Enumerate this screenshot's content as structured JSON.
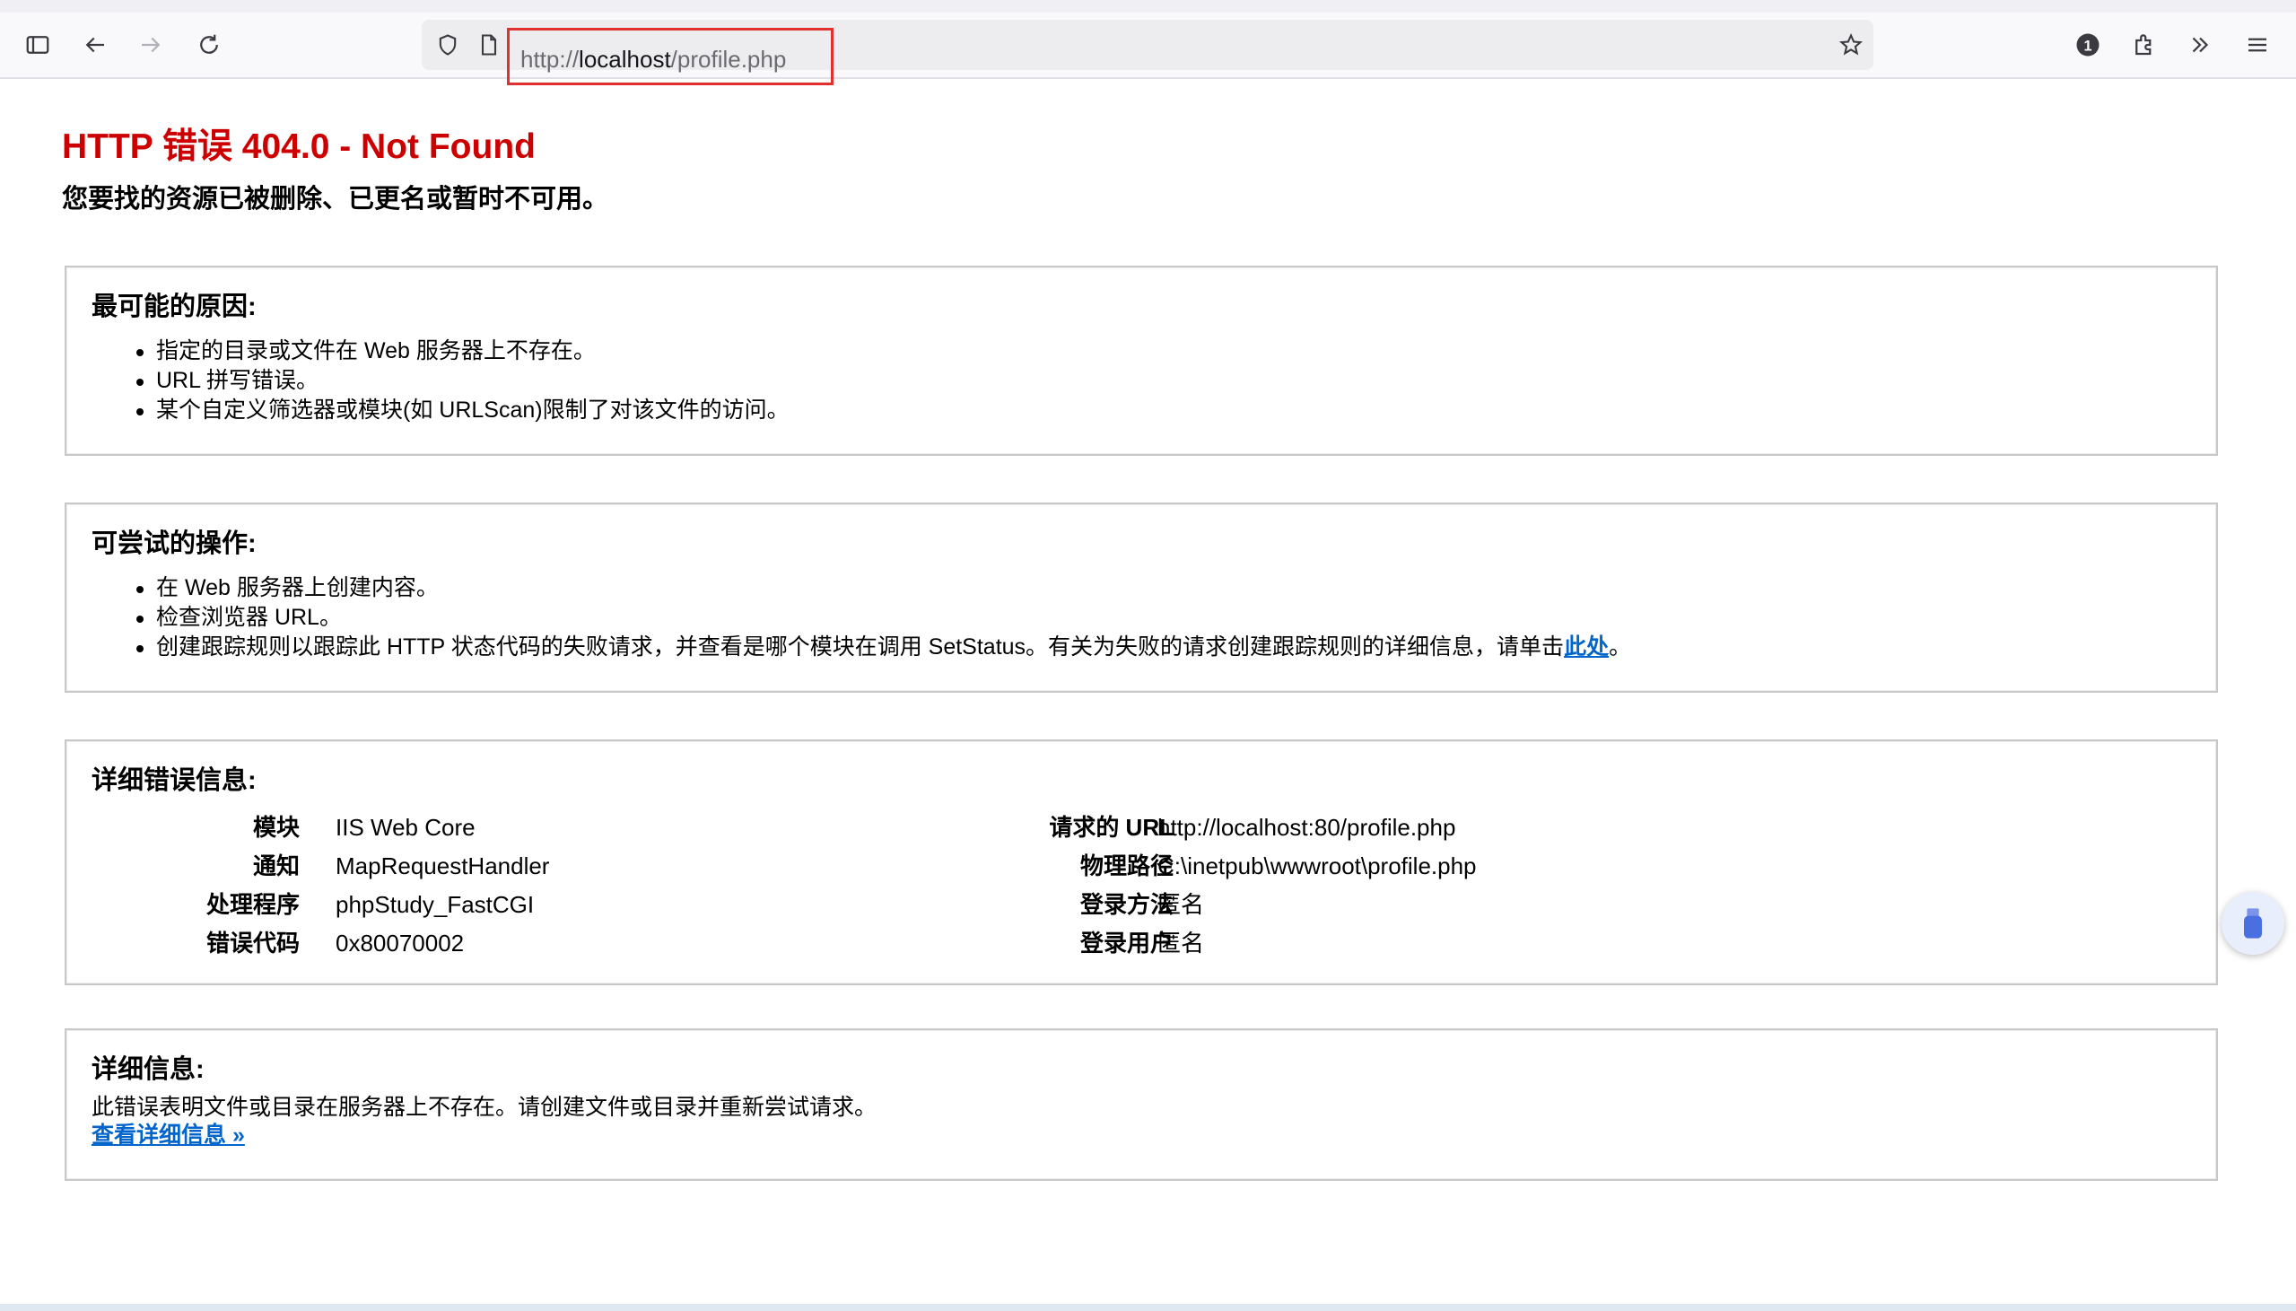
{
  "browser": {
    "url_prefix": "http://",
    "url_host": "localhost",
    "url_path": "/profile.php",
    "extensions_badge": "1"
  },
  "page": {
    "title": "HTTP 错误 404.0 - Not Found",
    "subtitle": "您要找的资源已被删除、已更名或暂时不可用。",
    "causes": {
      "heading": "最可能的原因:",
      "items": [
        "指定的目录或文件在 Web 服务器上不存在。",
        "URL 拼写错误。",
        "某个自定义筛选器或模块(如 URLScan)限制了对该文件的访问。"
      ]
    },
    "actions": {
      "heading": "可尝试的操作:",
      "items": [
        "在 Web 服务器上创建内容。",
        "检查浏览器 URL。"
      ],
      "trace_text": "创建跟踪规则以跟踪此 HTTP 状态代码的失败请求，并查看是哪个模块在调用 SetStatus。有关为失败的请求创建跟踪规则的详细信息，请单击",
      "trace_link": "此处",
      "trace_end": "。"
    },
    "details": {
      "heading": "详细错误信息:",
      "left": [
        {
          "label": "模块",
          "value": "IIS Web Core"
        },
        {
          "label": "通知",
          "value": "MapRequestHandler"
        },
        {
          "label": "处理程序",
          "value": "phpStudy_FastCGI"
        },
        {
          "label": "错误代码",
          "value": "0x80070002"
        }
      ],
      "right": [
        {
          "label": "请求的 URL",
          "value": "http://localhost:80/profile.php"
        },
        {
          "label": "物理路径",
          "value": "C:\\inetpub\\wwwroot\\profile.php"
        },
        {
          "label": "登录方法",
          "value": "匿名"
        },
        {
          "label": "登录用户",
          "value": "匿名"
        }
      ]
    },
    "more": {
      "heading": "详细信息:",
      "text": "此错误表明文件或目录在服务器上不存在。请创建文件或目录并重新尝试请求。",
      "link": "查看详细信息 »"
    }
  },
  "colors": {
    "title_red": "#cc0000",
    "link_blue": "#0066cc",
    "highlight_red": "#e03030"
  }
}
